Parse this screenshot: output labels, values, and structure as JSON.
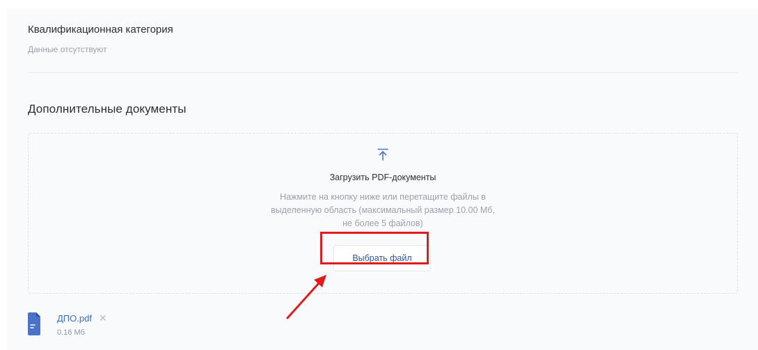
{
  "qualification": {
    "title": "Квалификационная категория",
    "value": "Данные отсутствуют"
  },
  "additional_documents": {
    "title": "Дополнительные документы",
    "dropzone": {
      "icon": "upload-icon",
      "title": "Загрузить PDF-документы",
      "description_lines": [
        "Нажмите на кнопку ниже или перетащите файлы в",
        "выделенную область (максимальный размер 10.00 Мб,",
        "не более 5 файлов)"
      ],
      "button_label": "Выбрать файл"
    },
    "files": [
      {
        "name": "ДПО.pdf",
        "size": "0.16 Мб",
        "icon": "document-icon",
        "remove_icon": "close-icon"
      }
    ]
  },
  "annotation": {
    "highlight_color": "#e11b1b",
    "arrow_color": "#e11b1b"
  },
  "colors": {
    "accent": "#2f5597",
    "link": "#3a6bc4",
    "file_icon": "#4a73c8",
    "text": "#2a2d34",
    "muted": "#9aa1ac"
  }
}
